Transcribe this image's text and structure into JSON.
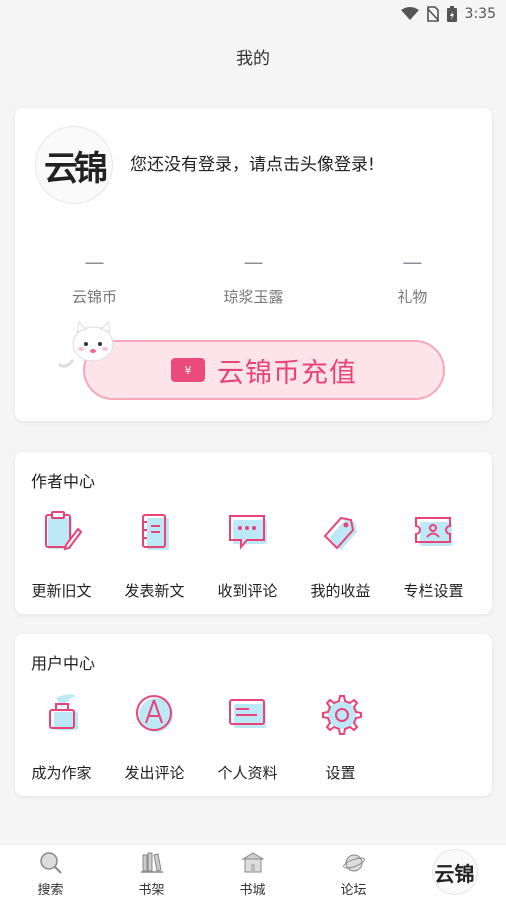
{
  "status_bar": {
    "time": "3:35"
  },
  "header": {
    "title": "我的"
  },
  "profile": {
    "login_prompt": "您还没有登录，请点击头像登录!",
    "avatar_text": "云锦",
    "stats": [
      {
        "value": "—",
        "label": "云锦币"
      },
      {
        "value": "—",
        "label": "琼浆玉露"
      },
      {
        "value": "—",
        "label": "礼物"
      }
    ],
    "recharge_label": "云锦币充值",
    "wallet_symbol": "¥"
  },
  "author_center": {
    "title": "作者中心",
    "items": [
      {
        "label": "更新旧文",
        "icon": "clipboard-pen-icon"
      },
      {
        "label": "发表新文",
        "icon": "notebook-icon"
      },
      {
        "label": "收到评论",
        "icon": "comment-icon"
      },
      {
        "label": "我的收益",
        "icon": "tag-icon"
      },
      {
        "label": "专栏设置",
        "icon": "ticket-icon"
      }
    ]
  },
  "user_center": {
    "title": "用户中心",
    "items": [
      {
        "label": "成为作家",
        "icon": "ink-bottle-icon"
      },
      {
        "label": "发出评论",
        "icon": "compass-pen-icon"
      },
      {
        "label": "个人资料",
        "icon": "id-card-icon"
      },
      {
        "label": "设置",
        "icon": "gear-icon"
      }
    ]
  },
  "tab_bar": {
    "tabs": [
      {
        "label": "搜索",
        "icon": "search-icon"
      },
      {
        "label": "书架",
        "icon": "bookshelf-icon"
      },
      {
        "label": "书城",
        "icon": "bookstore-icon"
      },
      {
        "label": "论坛",
        "icon": "forum-icon"
      },
      {
        "label": "",
        "icon": "avatar-icon"
      }
    ]
  },
  "colors": {
    "accent": "#e8447a",
    "accent_light": "#fde4ea",
    "icon_blue": "#a8dff0"
  }
}
